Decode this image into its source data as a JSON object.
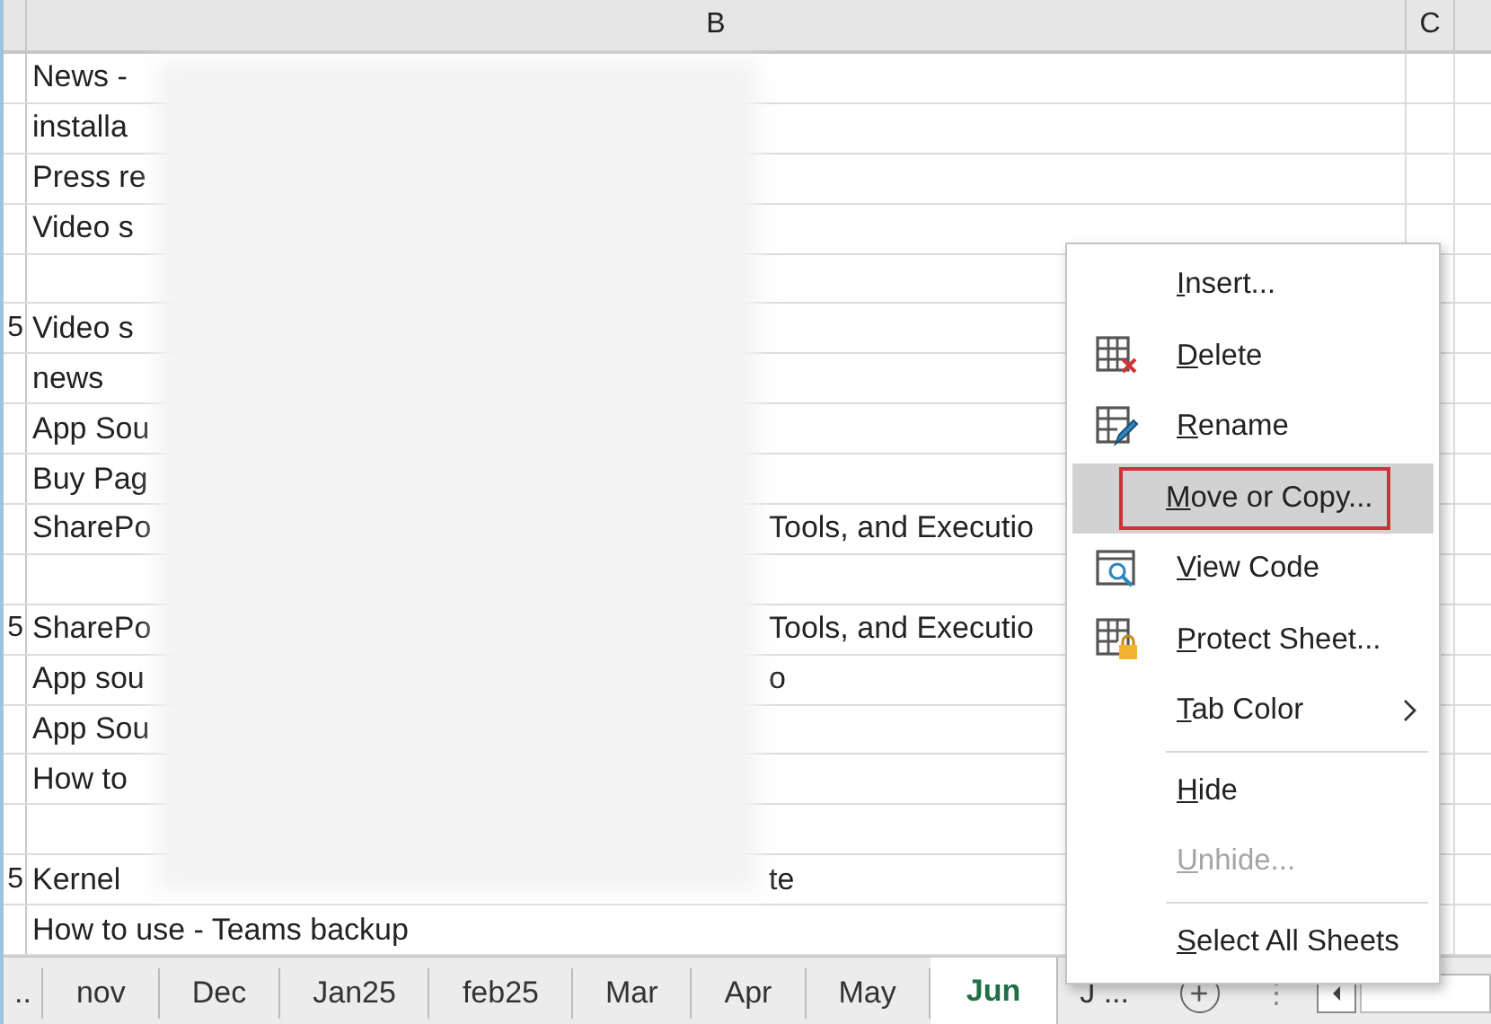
{
  "columns": [
    "B",
    "C"
  ],
  "rows": [
    {
      "number": "",
      "text": "News -",
      "tail": ""
    },
    {
      "number": "",
      "text": "installa",
      "tail": ""
    },
    {
      "number": "",
      "text": "Press re",
      "tail": ""
    },
    {
      "number": "",
      "text": "Video s",
      "tail": ""
    },
    {
      "number": "",
      "text": "",
      "tail": ""
    },
    {
      "number": "5",
      "text": "Video s",
      "tail": ""
    },
    {
      "number": "",
      "text": "news",
      "tail": ""
    },
    {
      "number": "",
      "text": "App Sou",
      "tail": ""
    },
    {
      "number": "",
      "text": "Buy Pag",
      "tail": ""
    },
    {
      "number": "",
      "text": "SharePo",
      "tail": "Tools, and Executio"
    },
    {
      "number": "",
      "text": "",
      "tail": ""
    },
    {
      "number": "5",
      "text": "SharePo",
      "tail": "Tools, and Executio"
    },
    {
      "number": "",
      "text": "App sou",
      "tail": "o"
    },
    {
      "number": "",
      "text": "App Sou",
      "tail": ""
    },
    {
      "number": "",
      "text": "How to",
      "tail": ""
    },
    {
      "number": "",
      "text": "",
      "tail": ""
    },
    {
      "number": "5",
      "text": "Kernel",
      "tail": "te"
    },
    {
      "number": "",
      "text": "How to use - Teams backup",
      "tail": ""
    }
  ],
  "sheet_tabs": [
    {
      "label": "..",
      "selected": false
    },
    {
      "label": "nov",
      "selected": false
    },
    {
      "label": "Dec",
      "selected": false
    },
    {
      "label": "Jan25",
      "selected": false
    },
    {
      "label": "feb25",
      "selected": false
    },
    {
      "label": "Mar",
      "selected": false
    },
    {
      "label": "Apr",
      "selected": false
    },
    {
      "label": "May",
      "selected": false
    },
    {
      "label": "Jun",
      "selected": true
    },
    {
      "label": "J ...",
      "selected": false
    }
  ],
  "add_sheet": "+",
  "tab_menu_dots": "⋮",
  "context_menu": [
    {
      "kind": "plain",
      "label": "Insert...",
      "selected": false,
      "disabled": false,
      "outlined": false
    },
    {
      "kind": "delete",
      "label": "Delete",
      "selected": false,
      "disabled": false,
      "outlined": false
    },
    {
      "kind": "rename",
      "label": "Rename",
      "selected": false,
      "disabled": false,
      "outlined": false
    },
    {
      "kind": "plain",
      "label": "Move or Copy...",
      "selected": true,
      "disabled": false,
      "outlined": true
    },
    {
      "kind": "code",
      "label": "View Code",
      "selected": false,
      "disabled": false,
      "outlined": false
    },
    {
      "kind": "protect",
      "label": "Protect Sheet...",
      "selected": false,
      "disabled": false,
      "outlined": false
    },
    {
      "kind": "submenu",
      "label": "Tab Color",
      "selected": false,
      "disabled": false,
      "outlined": false
    },
    {
      "kind": "separator"
    },
    {
      "kind": "plain",
      "label": "Hide",
      "selected": false,
      "disabled": false,
      "outlined": false
    },
    {
      "kind": "plain",
      "label": "Unhide...",
      "selected": false,
      "disabled": true,
      "outlined": false
    },
    {
      "kind": "separator"
    },
    {
      "kind": "plain",
      "label": "Select All Sheets",
      "selected": false,
      "disabled": false,
      "outlined": false
    }
  ]
}
